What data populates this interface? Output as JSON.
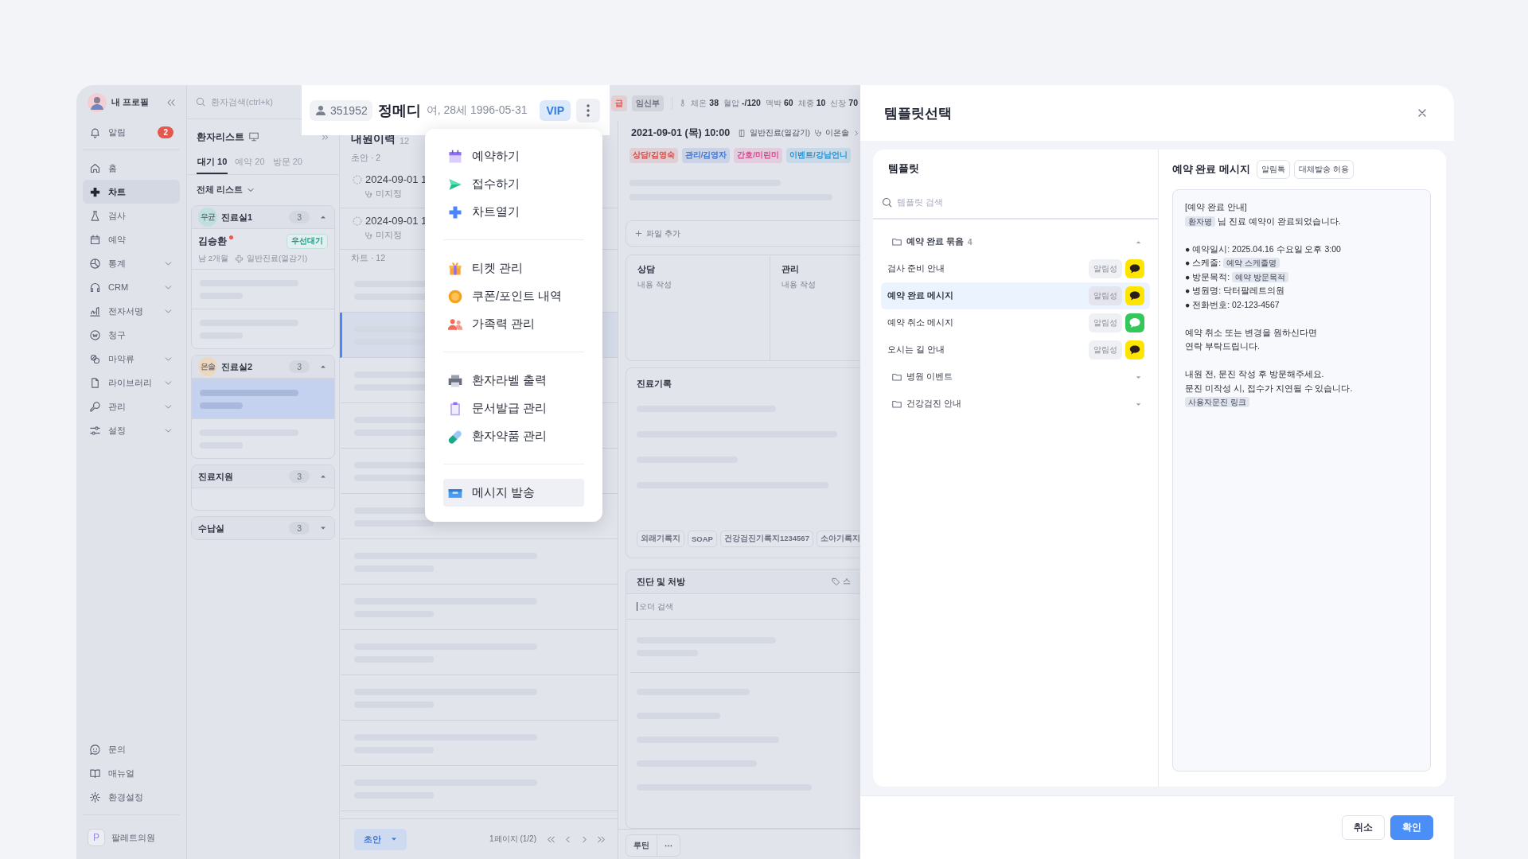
{
  "sidebar": {
    "profile": "내 프로필",
    "notification": {
      "label": "알림",
      "badge": "2"
    },
    "items": [
      {
        "label": "홈",
        "selected": false,
        "expandable": false
      },
      {
        "label": "차트",
        "selected": true,
        "expandable": false
      },
      {
        "label": "검사",
        "selected": false,
        "expandable": false
      },
      {
        "label": "예약",
        "selected": false,
        "expandable": false
      },
      {
        "label": "통계",
        "selected": false,
        "expandable": true
      },
      {
        "label": "CRM",
        "selected": false,
        "expandable": true
      },
      {
        "label": "전자서명",
        "selected": false,
        "expandable": true
      },
      {
        "label": "청구",
        "selected": false,
        "expandable": false
      },
      {
        "label": "마약류",
        "selected": false,
        "expandable": true
      },
      {
        "label": "라이브러리",
        "selected": false,
        "expandable": true
      },
      {
        "label": "관리",
        "selected": false,
        "expandable": true
      },
      {
        "label": "설정",
        "selected": false,
        "expandable": true
      }
    ],
    "bottom_items": [
      "문의",
      "매뉴얼",
      "환경설정"
    ],
    "clinic": {
      "logo_letter": "P",
      "name": "팔레트의원"
    }
  },
  "patient_list": {
    "search_placeholder": "환자검색(ctrl+k)",
    "title": "환자리스트",
    "tabs": [
      {
        "label": "대기 10",
        "selected": true
      },
      {
        "label": "예약 20",
        "selected": false
      },
      {
        "label": "방문 20",
        "selected": false
      }
    ],
    "filter": "전체 리스트",
    "groups": [
      {
        "name": "진료실1",
        "avatar": "우균",
        "color": "#bfe0dc",
        "count": "3",
        "expanded": true,
        "rows": [
          {
            "kind": "patient",
            "name": "김승환",
            "alert": true,
            "badge": "우선대기",
            "info": "남 2개월",
            "visit": "일반진료(열감기)",
            "selected": false
          },
          {
            "kind": "placeholder",
            "selected": false
          },
          {
            "kind": "placeholder",
            "selected": false
          }
        ]
      },
      {
        "name": "진료실2",
        "avatar": "은솔",
        "color": "#ecd8bf",
        "count": "3",
        "expanded": true,
        "rows": [
          {
            "kind": "placeholder",
            "selected": true
          },
          {
            "kind": "placeholder",
            "selected": false
          }
        ]
      },
      {
        "name": "진료지원",
        "count": "3",
        "expanded": true,
        "rows": [
          {
            "kind": "empty"
          }
        ]
      },
      {
        "name": "수납실",
        "count": "3",
        "expanded": false
      }
    ]
  },
  "patient_header": {
    "id": "351952",
    "name": "정메디",
    "info": "여, 28세 1996-05-31",
    "grade": "VIP",
    "tags": [
      {
        "label": "급",
        "color": "#e0564f"
      },
      {
        "label": "임신부",
        "color": "#6b7080"
      }
    ],
    "vitals": [
      {
        "label": "체온",
        "value": "38"
      },
      {
        "label": "혈압",
        "value": "-/120"
      },
      {
        "label": "맥박",
        "value": "60"
      },
      {
        "label": "체중",
        "value": "10"
      },
      {
        "label": "신장",
        "value": "70"
      }
    ]
  },
  "menu": {
    "groups": [
      {
        "items": [
          {
            "label": "예약하기",
            "selected": false
          },
          {
            "label": "접수하기",
            "selected": false
          },
          {
            "label": "차트열기",
            "selected": false
          }
        ]
      },
      {
        "items": [
          {
            "label": "티켓 관리",
            "selected": false
          },
          {
            "label": "쿠폰/포인트 내역",
            "selected": false
          },
          {
            "label": "가족력 관리",
            "selected": false
          }
        ]
      },
      {
        "items": [
          {
            "label": "환자라벨 출력",
            "selected": false
          },
          {
            "label": "문서발급 관리",
            "selected": false
          },
          {
            "label": "환자약품 관리",
            "selected": false
          }
        ]
      },
      {
        "items": [
          {
            "label": "메시지 발송",
            "selected": true
          }
        ]
      }
    ]
  },
  "visits": {
    "title": "내원이력",
    "count": "12",
    "sections": [
      {
        "label": "초안 · 2",
        "rows": [
          {
            "kind": "entry",
            "date": "2024-09-01 1",
            "doctor": "미지정",
            "selected": false
          },
          {
            "kind": "entry",
            "date": "2024-09-01 1",
            "doctor": "미지정",
            "selected": false
          }
        ]
      },
      {
        "label": "차트 · 12",
        "rows": [
          {
            "kind": "placeholder",
            "selected": false
          },
          {
            "kind": "placeholder",
            "selected": true
          },
          {
            "kind": "placeholder",
            "selected": false
          },
          {
            "kind": "placeholder",
            "selected": false
          },
          {
            "kind": "placeholder",
            "selected": false
          },
          {
            "kind": "placeholder",
            "selected": false
          },
          {
            "kind": "placeholder",
            "selected": false
          },
          {
            "kind": "placeholder",
            "selected": false
          },
          {
            "kind": "placeholder",
            "selected": false
          },
          {
            "kind": "placeholder",
            "selected": false
          },
          {
            "kind": "placeholder",
            "selected": false
          },
          {
            "kind": "placeholder",
            "selected": false
          }
        ]
      }
    ],
    "footer": {
      "draft_button": "초안",
      "page": "1페이지 (1/2)"
    }
  },
  "chart": {
    "date": "2021-09-01 (목) 10:00",
    "visit_type": "일반진료(열감기)",
    "doctor": "이은솔",
    "staff_tags": [
      {
        "label": "상담/김영숙",
        "color": "#d04b45"
      },
      {
        "label": "관리/김영자",
        "color": "#3b74d0"
      },
      {
        "label": "간호/미린미",
        "color": "#d9458f"
      },
      {
        "label": "이벤트/강남언니",
        "color": "#2492d6"
      }
    ],
    "add_file": "파일 추가",
    "notes": [
      {
        "title": "상담",
        "placeholder": "내용 작성"
      },
      {
        "title": "관리",
        "placeholder": "내용 작성"
      }
    ],
    "record": {
      "title": "진료기록",
      "forms": [
        "외래기록지",
        "SOAP",
        "건강검진기록지1234567",
        "소아기록지"
      ]
    },
    "prescription": {
      "title": "진단 및 처방",
      "action": "스",
      "search_placeholder": "오더 검색"
    },
    "footer": {
      "routine": "루틴",
      "more": "⋯"
    }
  },
  "template_modal": {
    "title": "템플릿선택",
    "panel_title": "템플릿",
    "search_placeholder": "템플릿 검색",
    "folders": [
      {
        "name": "예약 완료 묶음",
        "count": "4",
        "expanded": true,
        "items": [
          {
            "name": "검사 준비 안내",
            "type": "알림성",
            "kind": "kakao",
            "color": "#fee500",
            "selected": false
          },
          {
            "name": "예약 완료 메시지",
            "type": "알림성",
            "kind": "kakao",
            "color": "#fee500",
            "selected": true
          },
          {
            "name": "예약 취소 메시지",
            "type": "알림성",
            "kind": "sms",
            "color": "#34c759",
            "selected": false
          },
          {
            "name": "오시는 길 안내",
            "type": "알림성",
            "kind": "kakao",
            "color": "#fee500",
            "selected": false
          }
        ]
      },
      {
        "name": "병원 이벤트",
        "expanded": false
      },
      {
        "name": "건강검진 안내",
        "expanded": false
      }
    ],
    "preview": {
      "title": "예약 완료 메시지",
      "badges": [
        "알림톡",
        "대체발송 허용"
      ],
      "lines": [
        {
          "kind": "line",
          "parts": [
            {
              "kind": "text",
              "text": "[예약 완료 안내]"
            }
          ]
        },
        {
          "kind": "line",
          "parts": [
            {
              "kind": "variable",
              "text": "환자명"
            },
            {
              "kind": "text",
              "text": " 님 진료 예약이 완료되었습니다."
            }
          ]
        },
        {
          "kind": "blank"
        },
        {
          "kind": "line",
          "parts": [
            {
              "kind": "text",
              "text": "● 예약일시: 2025.04.16 수요일 오후 3:00"
            }
          ]
        },
        {
          "kind": "line",
          "parts": [
            {
              "kind": "text",
              "text": "● 스케줄: "
            },
            {
              "kind": "variable",
              "text": "예약 스케줄명"
            }
          ]
        },
        {
          "kind": "line",
          "parts": [
            {
              "kind": "text",
              "text": "● 방문목적: "
            },
            {
              "kind": "variable",
              "text": "예약 방문목적"
            }
          ]
        },
        {
          "kind": "line",
          "parts": [
            {
              "kind": "text",
              "text": "● 병원명: 닥터팔레트의원"
            }
          ]
        },
        {
          "kind": "line",
          "parts": [
            {
              "kind": "text",
              "text": "● 전화번호: 02-123-4567"
            }
          ]
        },
        {
          "kind": "blank"
        },
        {
          "kind": "line",
          "parts": [
            {
              "kind": "text",
              "text": "예약 취소 또는 변경을 원하신다면"
            }
          ]
        },
        {
          "kind": "line",
          "parts": [
            {
              "kind": "text",
              "text": "연락 부탁드립니다."
            }
          ]
        },
        {
          "kind": "blank"
        },
        {
          "kind": "line",
          "parts": [
            {
              "kind": "text",
              "text": "내원 전, 문진 작성 후 방문해주세요."
            }
          ]
        },
        {
          "kind": "line",
          "parts": [
            {
              "kind": "text",
              "text": "문진 미작성 시, 접수가 지연될 수 있습니다."
            }
          ]
        },
        {
          "kind": "line",
          "parts": [
            {
              "kind": "variable",
              "text": "사용자문진 링크"
            }
          ]
        }
      ]
    },
    "buttons": [
      {
        "label": "취소",
        "kind": "secondary"
      },
      {
        "label": "확인",
        "kind": "primary"
      }
    ]
  }
}
